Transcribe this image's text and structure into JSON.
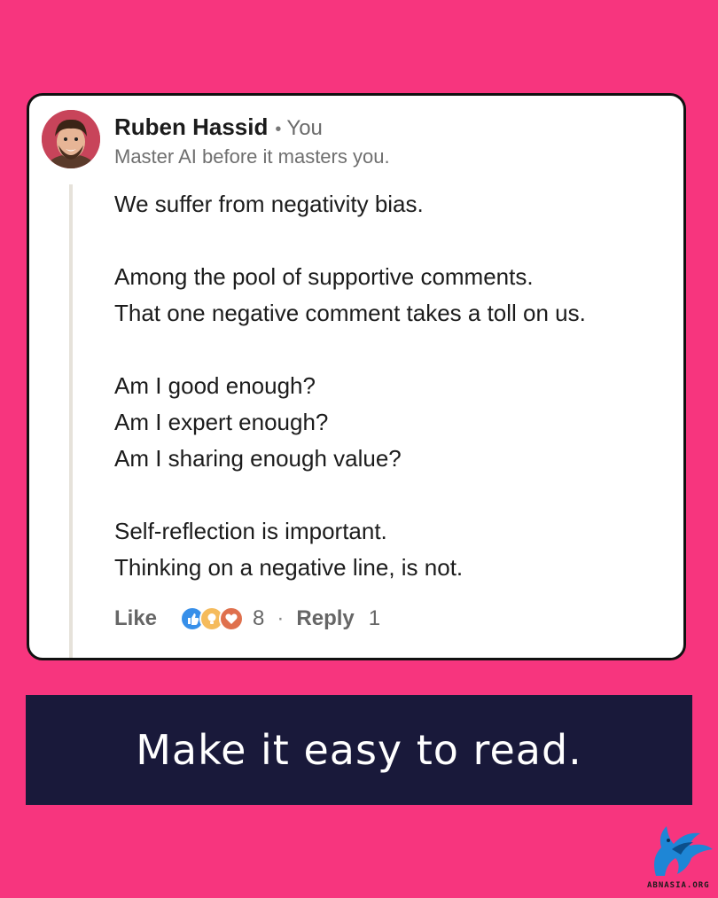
{
  "comment": {
    "author_name": "Ruben Hassid",
    "separator": "•",
    "relationship": "You",
    "headline": "Master AI before it masters you.",
    "paragraphs": [
      [
        "We suffer from negativity bias."
      ],
      [
        "Among the pool of supportive comments.",
        "That one negative comment takes a toll on us."
      ],
      [
        "Am I good enough?",
        "Am I expert enough?",
        "Am I sharing enough value?"
      ],
      [
        "Self-reflection is important.",
        "Thinking on a negative line, is not."
      ]
    ],
    "actions": {
      "like_label": "Like",
      "reaction_icons": [
        "like-icon",
        "insightful-icon",
        "love-icon"
      ],
      "reaction_count": "8",
      "dot": "·",
      "reply_label": "Reply",
      "reply_count": "1"
    }
  },
  "banner": {
    "text": "Make it easy to read."
  },
  "watermark": {
    "text": "ABNASIA.ORG"
  },
  "colors": {
    "background": "#F7357E",
    "banner": "#19193A",
    "like_reaction": "#378FE9",
    "insight_reaction": "#F5BB5C",
    "love_reaction": "#DF704D"
  }
}
